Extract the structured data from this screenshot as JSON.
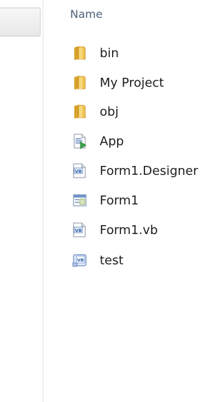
{
  "header": {
    "name_label": "Name"
  },
  "files": [
    {
      "name": "bin",
      "icon": "folder-icon"
    },
    {
      "name": "My Project",
      "icon": "folder-icon"
    },
    {
      "name": "obj",
      "icon": "folder-icon"
    },
    {
      "name": "App",
      "icon": "config-file-icon"
    },
    {
      "name": "Form1.Designer",
      "icon": "vb-file-icon"
    },
    {
      "name": "Form1",
      "icon": "form-file-icon"
    },
    {
      "name": "Form1.vb",
      "icon": "vb-file-icon"
    },
    {
      "name": "test",
      "icon": "vb-project-icon"
    }
  ]
}
